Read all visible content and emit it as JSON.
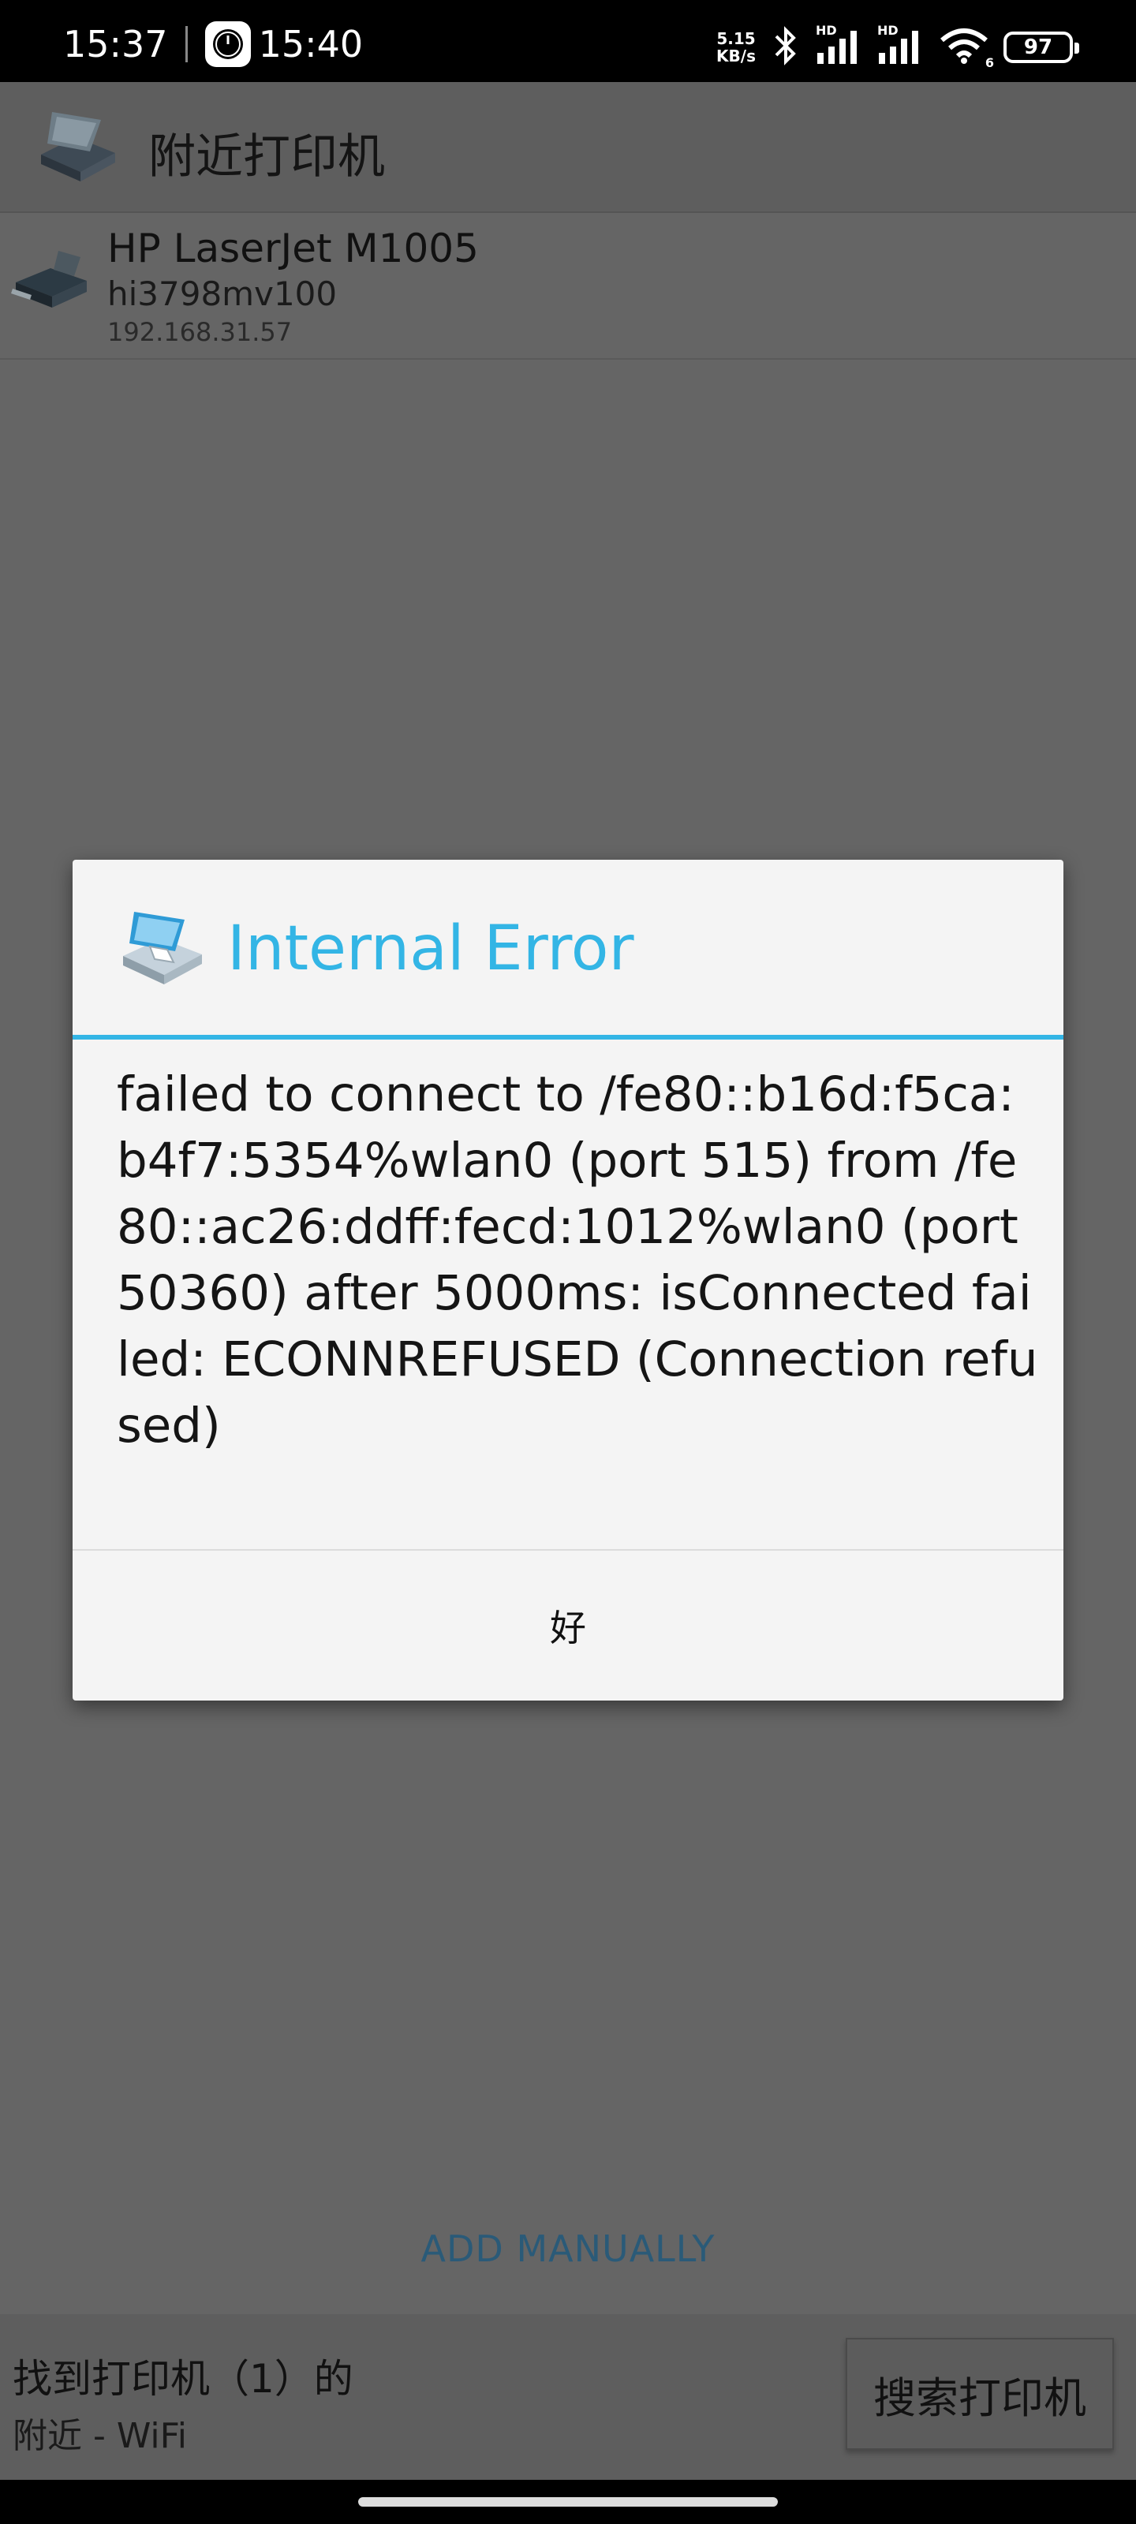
{
  "status_bar": {
    "time_left": "15:37",
    "time_right": "15:40",
    "net_speed_value": "5.15",
    "net_speed_unit": "KB/s",
    "signal_label_1": "HD",
    "signal_label_2": "HD",
    "wifi_label": "6",
    "battery": "97",
    "icons": [
      "clock-icon",
      "bluetooth-icon",
      "signal-icon",
      "signal-icon",
      "wifi-icon",
      "battery-icon"
    ]
  },
  "appbar": {
    "title": "附近打印机",
    "logo_icon": "printer-app-logo-icon"
  },
  "printers": [
    {
      "name": "HP LaserJet M1005",
      "host": "hi3798mv100",
      "ip": "192.168.31.57",
      "icon": "printer-icon"
    }
  ],
  "add_manually": "ADD MANUALLY",
  "footer": {
    "found_text": "找到打印机（1）的",
    "found_sub": "附近 - WiFi",
    "search_button": "搜索打印机"
  },
  "dialog": {
    "title": "Internal Error",
    "message": "failed to connect to /fe80::b16d:f5ca:b4f7:5354%wlan0 (port 515) from /fe80::ac26:ddff:fecd:1012%wlan0 (port 50360) after 5000ms: isConnected failed: ECONNREFUSED (Connection refused)",
    "ok_button": "好",
    "accent_color": "#33b5e5"
  }
}
